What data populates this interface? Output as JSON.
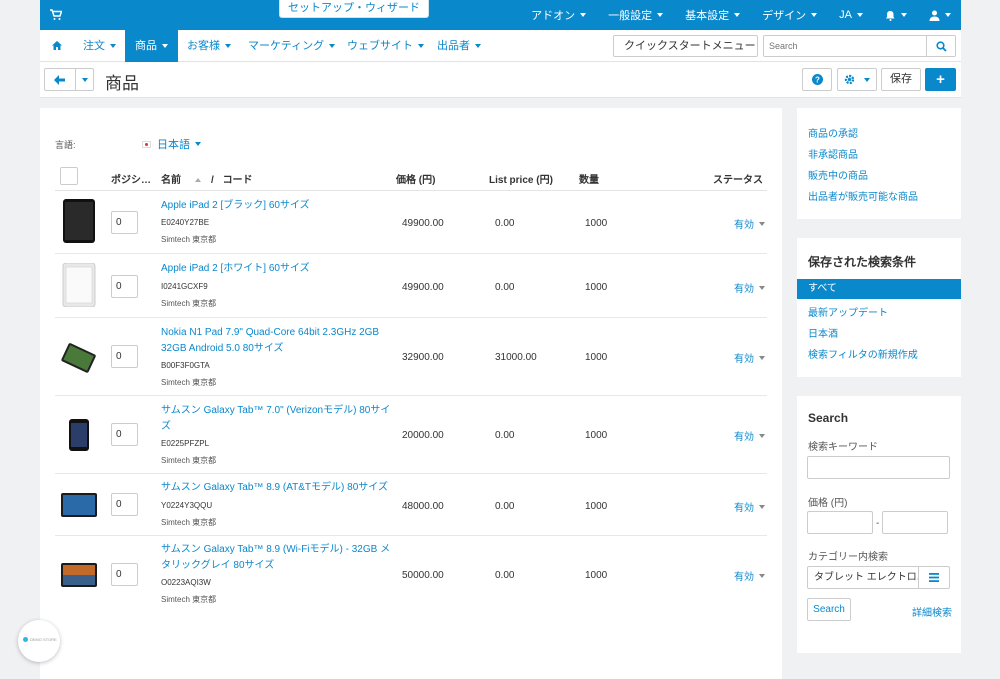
{
  "topbar": {
    "wizard_label": "セットアップ・ウィザード",
    "items": [
      {
        "label": "アドオン"
      },
      {
        "label": "一般設定"
      },
      {
        "label": "基本設定"
      },
      {
        "label": "デザイン"
      },
      {
        "label": "JA"
      }
    ],
    "accent": "#0a88cc"
  },
  "subnav": {
    "items": [
      {
        "label": "注文"
      },
      {
        "label": "商品"
      },
      {
        "label": "お客様"
      },
      {
        "label": "マーケティング"
      },
      {
        "label": "ウェブサイト"
      },
      {
        "label": "出品者"
      }
    ],
    "quickstart_label": "クイックスタートメニュー",
    "search_placeholder": "Search"
  },
  "titlebar": {
    "title": "商品",
    "save_label": "保存",
    "add_label": "+"
  },
  "main": {
    "lang_label": "言語:",
    "lang_value": "日本語",
    "columns": {
      "position": "ポジシ…",
      "name": "名前",
      "slash": "/",
      "code": "コード",
      "price": "価格 (円)",
      "list_price": "List price (円)",
      "qty": "数量",
      "status": "ステータス"
    },
    "rows": [
      {
        "name": "Apple iPad 2 [ブラック] 60サイズ",
        "code": "E0240Y27BE",
        "vendor": "Simtech 東京都",
        "position": "0",
        "price": "49900.00",
        "list_price": "0.00",
        "qty": "1000",
        "status": "有効"
      },
      {
        "name": "Apple iPad 2 [ホワイト] 60サイズ",
        "code": "I0241GCXF9",
        "vendor": "Simtech 東京都",
        "position": "0",
        "price": "49900.00",
        "list_price": "0.00",
        "qty": "1000",
        "status": "有効"
      },
      {
        "name": "Nokia N1 Pad 7.9\" Quad-Core 64bit 2.3GHz 2GB 32GB Android 5.0 80サイズ",
        "code": "B00F3F0GTA",
        "vendor": "Simtech 東京都",
        "position": "0",
        "price": "32900.00",
        "list_price": "31000.00",
        "qty": "1000",
        "status": "有効"
      },
      {
        "name": "サムスン Galaxy Tab™ 7.0\" (Verizonモデル) 80サイズ",
        "code": "E0225PFZPL",
        "vendor": "Simtech 東京都",
        "position": "0",
        "price": "20000.00",
        "list_price": "0.00",
        "qty": "1000",
        "status": "有効"
      },
      {
        "name": "サムスン Galaxy Tab™ 8.9 (AT&Tモデル) 80サイズ",
        "code": "Y0224Y3QQU",
        "vendor": "Simtech 東京都",
        "position": "0",
        "price": "48000.00",
        "list_price": "0.00",
        "qty": "1000",
        "status": "有効"
      },
      {
        "name": "サムスン Galaxy Tab™ 8.9 (Wi-Fiモデル) - 32GB メタリックグレイ 80サイズ",
        "code": "O0223AQI3W",
        "vendor": "Simtech 東京都",
        "position": "0",
        "price": "50000.00",
        "list_price": "0.00",
        "qty": "1000",
        "status": "有効"
      }
    ]
  },
  "sidebar": {
    "links": [
      {
        "label": "商品の承認"
      },
      {
        "label": "非承認商品"
      },
      {
        "label": "販売中の商品"
      },
      {
        "label": "出品者が販売可能な商品"
      }
    ],
    "saved": {
      "title": "保存された検索条件",
      "items": [
        {
          "label": "すべて"
        },
        {
          "label": "最新アップデート"
        },
        {
          "label": "日本酒"
        },
        {
          "label": "検索フィルタの新規作成"
        }
      ]
    },
    "search": {
      "title": "Search",
      "keyword_label": "検索キーワード",
      "price_label": "価格 (円)",
      "price_sep": "-",
      "category_label": "カテゴリー内検索",
      "category_value": "タブレット エレクトロニクス",
      "search_button": "Search",
      "advanced_link": "詳細検索"
    }
  },
  "badge": {
    "label": "DEMO STORE"
  }
}
